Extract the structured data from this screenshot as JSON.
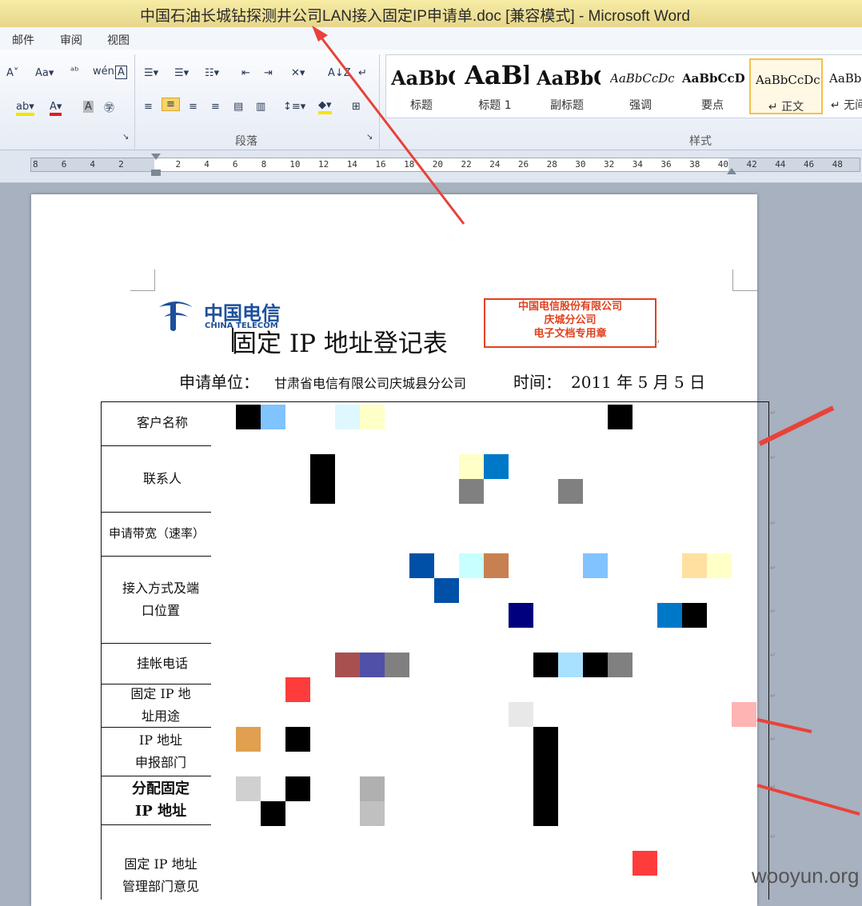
{
  "window": {
    "title": "中国石油长城钻探测井公司LAN接入固定IP申请单.doc [兼容模式] - Microsoft Word"
  },
  "menubar": {
    "items": [
      "邮件",
      "审阅",
      "视图"
    ]
  },
  "ribbon": {
    "groups": {
      "paragraph": "段落",
      "styles": "样式"
    },
    "style_samples": [
      {
        "sample": "AaBbC",
        "label": "标题"
      },
      {
        "sample": "AaBl",
        "label": "标题 1"
      },
      {
        "sample": "AaBbC",
        "label": "副标题"
      },
      {
        "sample": "AaBbCcDc",
        "label": "强调"
      },
      {
        "sample": "AaBbCcD",
        "label": "要点"
      },
      {
        "sample": "AaBbCcDc",
        "label": "↵ 正文"
      },
      {
        "sample": "AaBbC",
        "label": "↵ 无间"
      }
    ]
  },
  "ruler": {
    "numbers": [
      "8",
      "6",
      "4",
      "2",
      "",
      "2",
      "4",
      "6",
      "8",
      "10",
      "12",
      "14",
      "16",
      "18",
      "20",
      "22",
      "24",
      "26",
      "28",
      "30",
      "32",
      "34",
      "36",
      "38",
      "40",
      "42",
      "44",
      "46",
      "48"
    ]
  },
  "document": {
    "logo_cn": "中国电信",
    "logo_en": "CHINA TELECOM",
    "stamp_lines": [
      "中国电信股份有限公司",
      "庆城分公司",
      "电子文档专用章"
    ],
    "title": "固定 IP 地址登记表",
    "applicant_label": "申请单位：",
    "applicant_value": "甘肃省电信有限公司庆城县分公司",
    "date_label": "时间：",
    "date_value": "2011 年 5 月 5 日",
    "rows": [
      {
        "label": "客户名称"
      },
      {
        "label": "联系人"
      },
      {
        "label": "申请带宽（速率）"
      },
      {
        "label_lines": [
          "接入方式及端",
          "口位置"
        ]
      },
      {
        "label": "挂帐电话"
      },
      {
        "label_lines": [
          "固定 IP 地",
          "址用途"
        ]
      },
      {
        "label_lines": [
          "IP 地址",
          "申报部门"
        ]
      },
      {
        "label_lines": [
          "分配固定",
          "IP 地址"
        ]
      },
      {
        "label_lines": [
          "固定 IP 地址",
          "管理部门意见"
        ]
      }
    ]
  },
  "watermark": "wooyun.org",
  "colors": {
    "arrow": "#e8423a",
    "stamp": "#e0421f",
    "logo": "#1d4f9b"
  }
}
